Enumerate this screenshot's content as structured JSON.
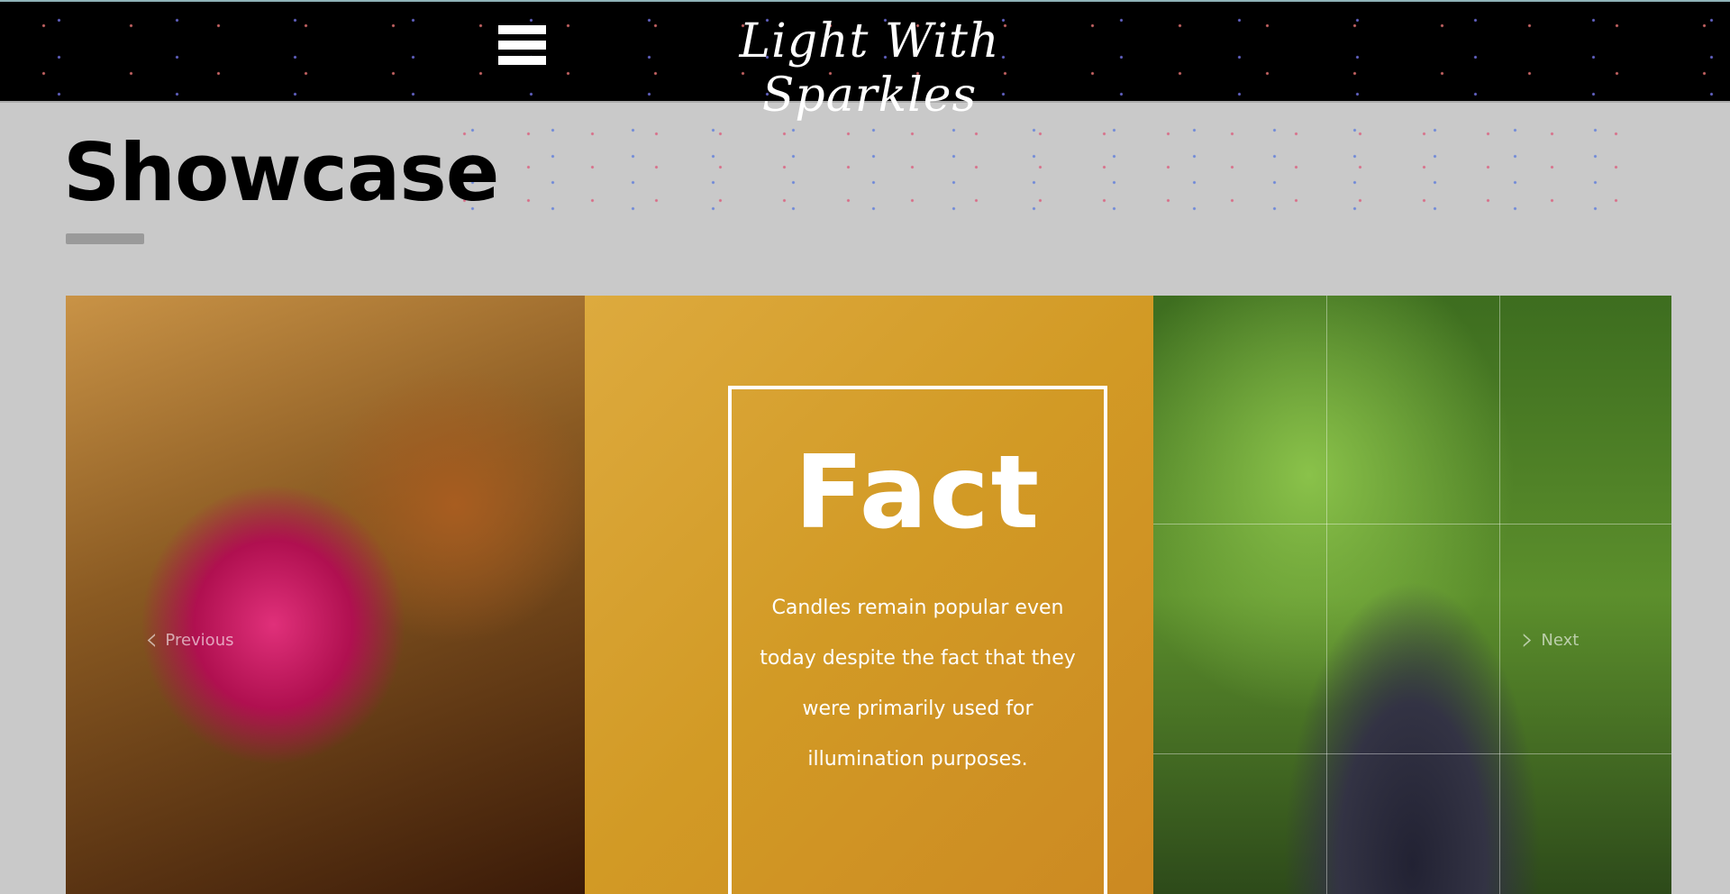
{
  "header": {
    "site_title": "Light With Sparkles"
  },
  "page": {
    "title": "Showcase"
  },
  "showcase": {
    "fact_title": "Fact",
    "fact_text": "Candles remain popular even today despite the fact that they were primarily used for illumination purposes.",
    "previous_label": "Previous",
    "next_label": "Next"
  }
}
